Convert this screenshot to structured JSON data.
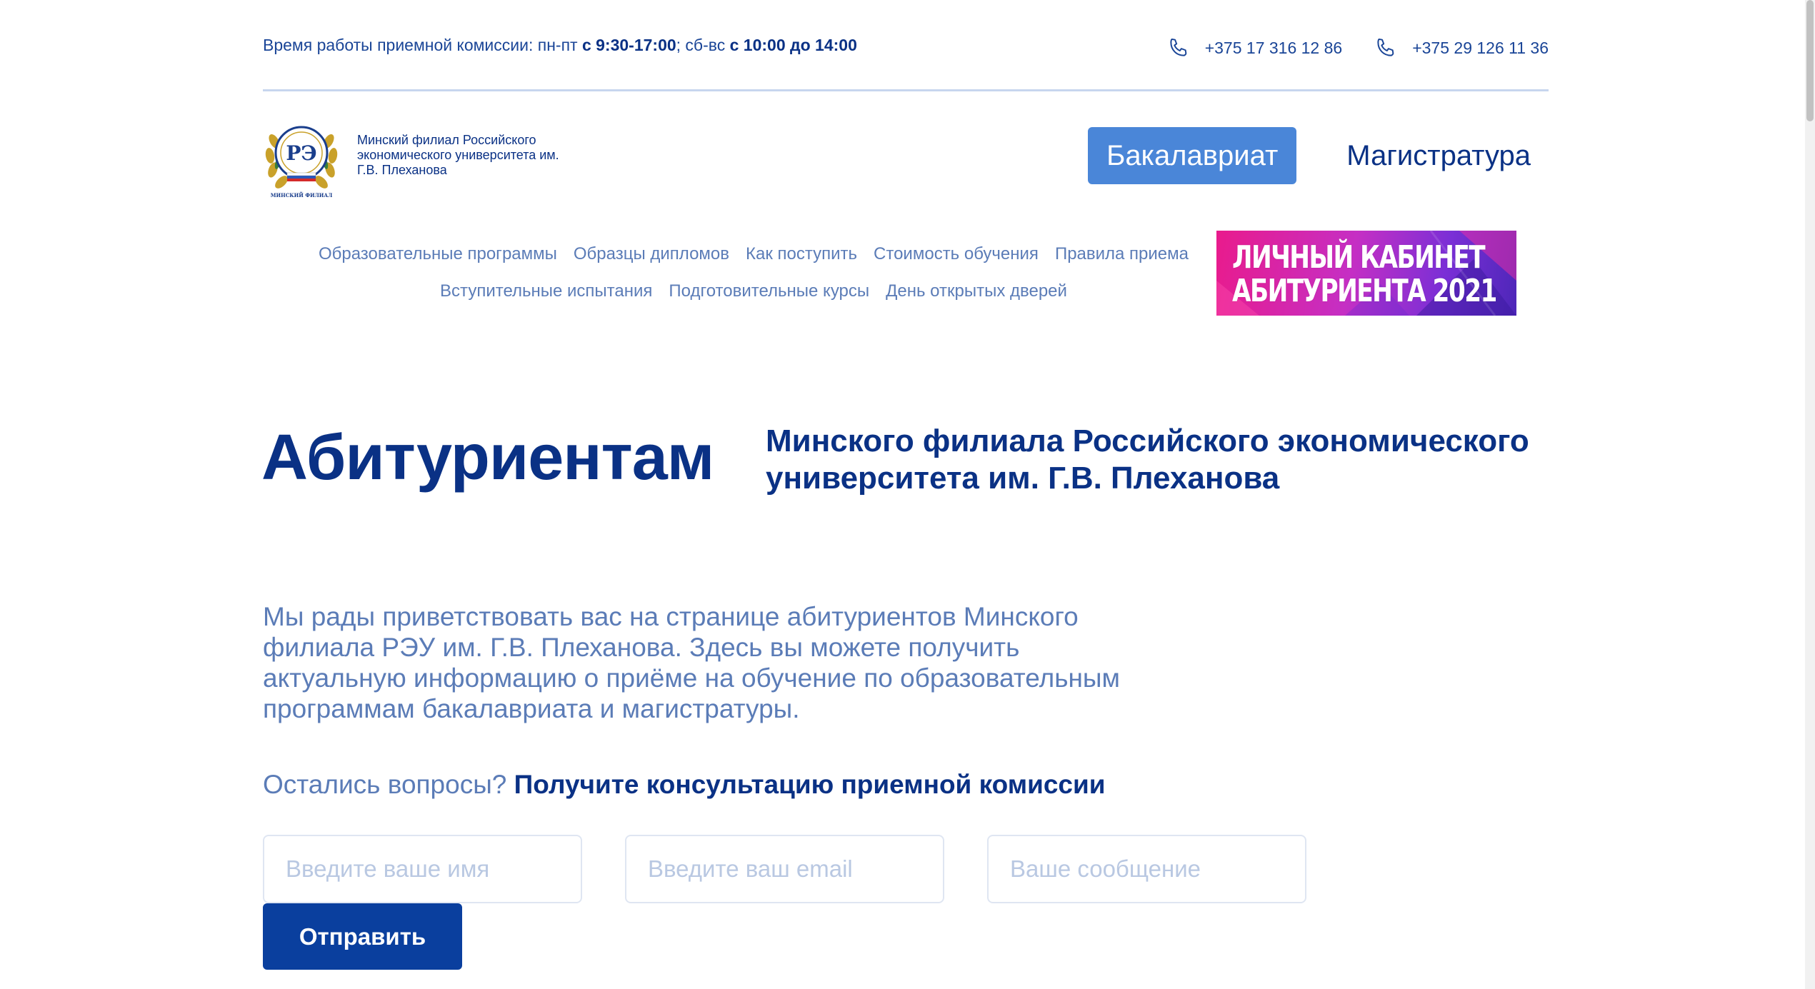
{
  "topbar": {
    "hours_prefix": "Время работы приемной комиссии: пн-пт ",
    "hours_weekdays": "с 9:30-17:00",
    "hours_mid": "; сб-вс ",
    "hours_weekend": "с 10:00 до 14:00",
    "phones": [
      "+375 17 316 12 86",
      "+375 29 126 11 36"
    ]
  },
  "header": {
    "logo_caption": "МИНСКИЙ ФИЛИАЛ",
    "org_name": "Минский филиал Российского экономического университета им. Г.В. Плеханова",
    "levels": [
      "Бакалавриат",
      "Магистратура"
    ],
    "active_level": "Бакалавриат"
  },
  "nav": {
    "row1": [
      "Образовательные программы",
      "Образцы дипломов",
      "Как поступить",
      "Стоимость обучения",
      "Правила приема"
    ],
    "row2": [
      "Вступительные испытания",
      "Подготовительные курсы",
      "День открытых дверей"
    ]
  },
  "banner": {
    "line1": "ЛИЧНЫЙ КАБИНЕТ",
    "line2": "АБИТУРИЕНТА 2021"
  },
  "hero": {
    "title": "Абитуриентам",
    "subtitle": "Минского филиала Российского экономического университета им. Г.В. Плеханова"
  },
  "intro": {
    "text": "Мы рады приветствовать вас на странице абитуриентов Минского филиала РЭУ им. Г.В. Плеханова. Здесь вы можете получить актуальную информацию о приёме на обучение по образовательным программам бакалавриата и магистратуры."
  },
  "questions": {
    "prefix": "Остались вопросы? ",
    "link": "Получите консультацию приемной комиссии"
  },
  "form": {
    "name_placeholder": "Введите ваше имя",
    "email_placeholder": "Введите ваш email",
    "message_placeholder": "Ваше сообщение",
    "submit_label": "Отправить"
  },
  "colors": {
    "brand_dark": "#0a3185",
    "brand_text": "#1a4597",
    "muted": "#5b7cb7",
    "accent_button": "#4a86d8",
    "submit_button": "#0a3f9e"
  },
  "icons": {
    "phone": "phone-icon",
    "logo": "university-emblem-icon"
  }
}
